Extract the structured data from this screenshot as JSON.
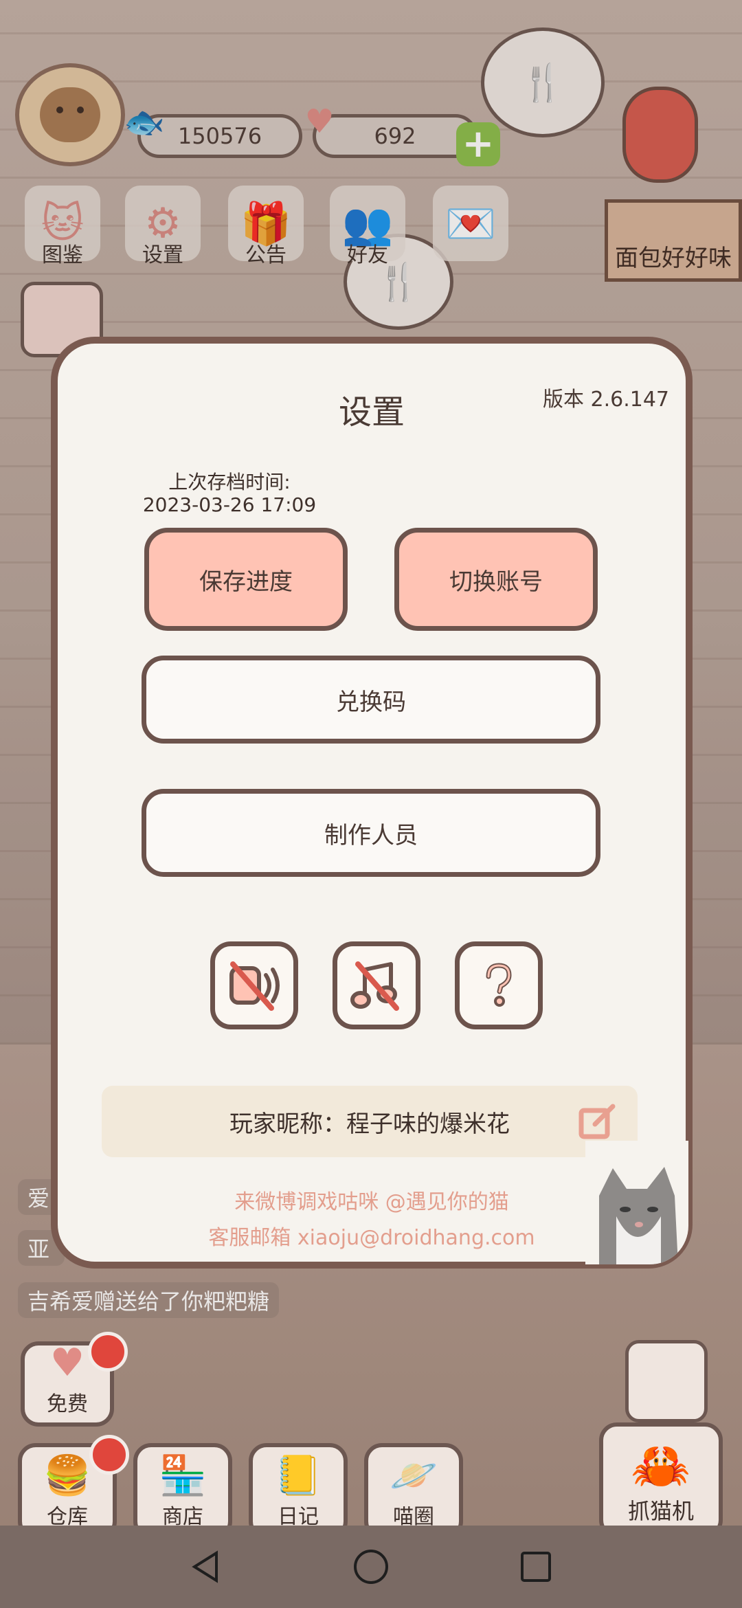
{
  "top_bar": {
    "coins": "150576",
    "hearts": "692",
    "menu": [
      {
        "label": "图鉴",
        "icon": "cat-face-icon"
      },
      {
        "label": "设置",
        "icon": "gear-icon"
      },
      {
        "label": "公告",
        "icon": "gift-icon"
      },
      {
        "label": "好友",
        "icon": "friends-icon"
      }
    ],
    "shop_tag": "面包好好味"
  },
  "chat": {
    "lines": [
      "爱",
      "亚",
      "吉希爱赠送给了你粑粑糖"
    ]
  },
  "bottom_nav": {
    "free": "免费",
    "items": [
      "仓库",
      "商店",
      "日记",
      "喵圈"
    ],
    "claw_machine": "抓猫机"
  },
  "dialog": {
    "title": "设置",
    "version": "版本 2.6.147",
    "save_time_label": "上次存档时间:",
    "save_time_value": "2023-03-26 17:09",
    "save_progress_button": "保存进度",
    "switch_account_button": "切换账号",
    "redeem_code_button": "兑换码",
    "credits_button": "制作人员",
    "nickname": "玩家昵称：程子味的爆米花",
    "weibo_link": "来微博调戏咕咪 @遇见你的猫",
    "support_email": "客服邮箱 xiaoju@droidhang.com"
  },
  "colors": {
    "dialog_border": "#7a5a50",
    "pink_button": "#ffc3b4",
    "link_text": "#e39e8d",
    "red_badge": "#e0463c"
  }
}
